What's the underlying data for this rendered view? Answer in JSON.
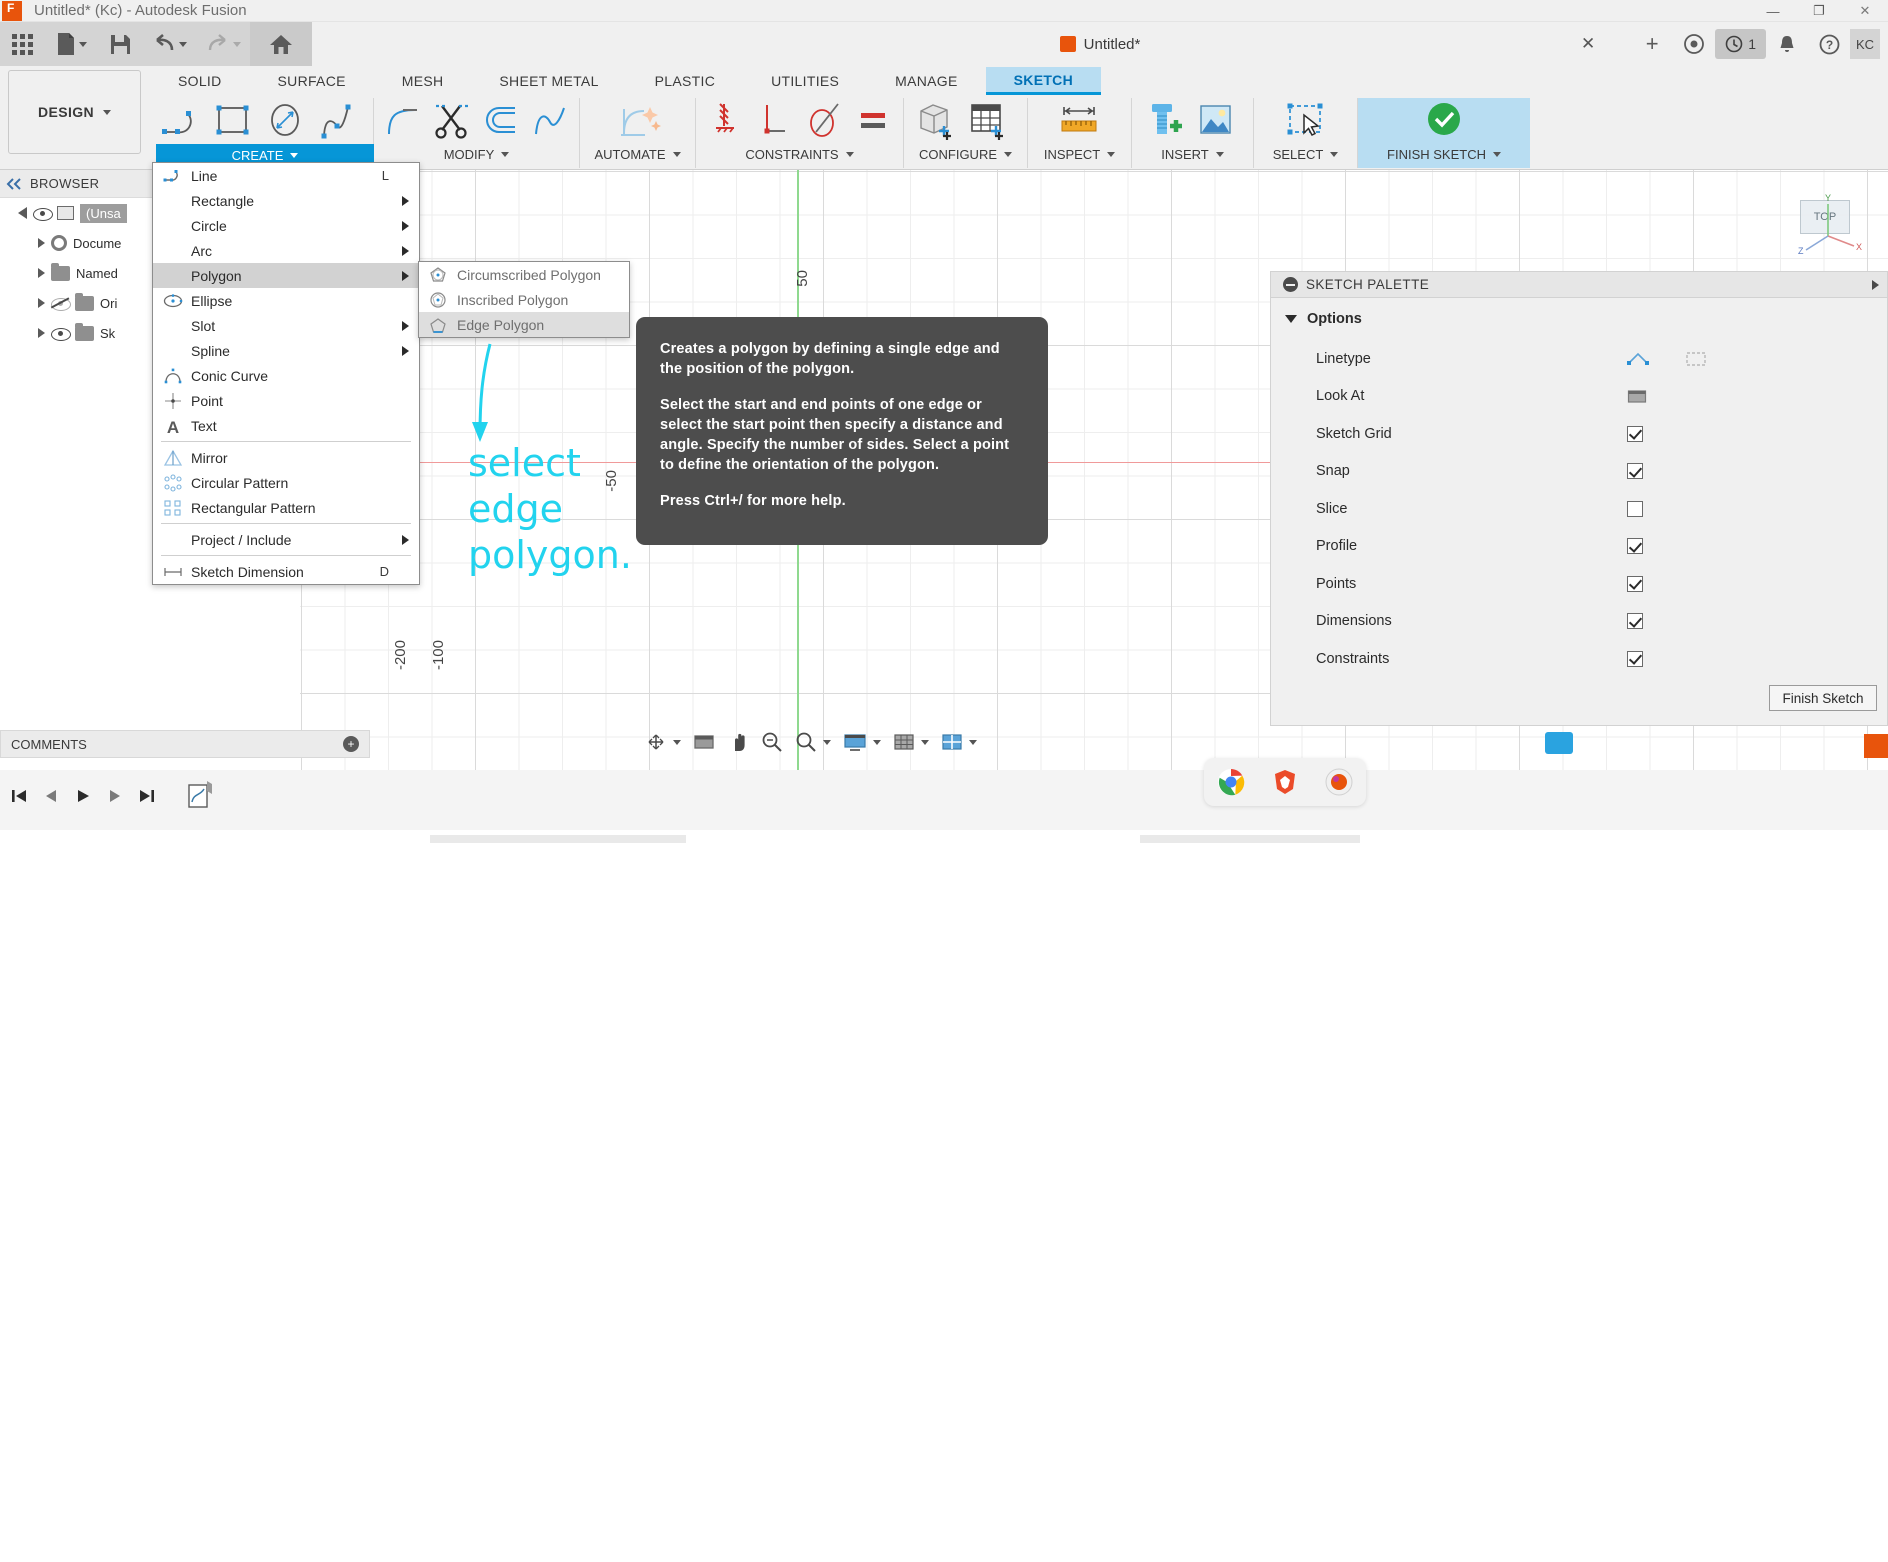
{
  "window": {
    "title": "Untitled* (Kc) - Autodesk Fusion",
    "minimize": "—",
    "maximize": "❐",
    "close": "✕"
  },
  "quick_access": {
    "grid_icon": "apps-grid-icon",
    "new_label": "new-document-icon",
    "save_label": "save-icon",
    "undo_label": "undo-icon",
    "redo_label": "redo-icon",
    "home_label": "home-icon",
    "document_tab": "Untitled*",
    "tab_close": "✕",
    "add_tab": "+",
    "help_badge": "1",
    "user_initials": "KC"
  },
  "ribbon": {
    "design_dropdown": "DESIGN",
    "tabs": [
      {
        "label": "SOLID",
        "active": false
      },
      {
        "label": "SURFACE",
        "active": false
      },
      {
        "label": "MESH",
        "active": false
      },
      {
        "label": "SHEET METAL",
        "active": false
      },
      {
        "label": "PLASTIC",
        "active": false
      },
      {
        "label": "UTILITIES",
        "active": false
      },
      {
        "label": "MANAGE",
        "active": false
      },
      {
        "label": "SKETCH",
        "active": true
      }
    ],
    "panels": [
      {
        "label": "CREATE",
        "dropdown": true,
        "active": true
      },
      {
        "label": "MODIFY",
        "dropdown": true,
        "active": false
      },
      {
        "label": "AUTOMATE",
        "dropdown": true,
        "active": false
      },
      {
        "label": "CONSTRAINTS",
        "dropdown": true,
        "active": false
      },
      {
        "label": "CONFIGURE",
        "dropdown": true,
        "active": false
      },
      {
        "label": "INSPECT",
        "dropdown": true,
        "active": false
      },
      {
        "label": "INSERT",
        "dropdown": true,
        "active": false
      },
      {
        "label": "SELECT",
        "dropdown": true,
        "active": false
      },
      {
        "label": "FINISH SKETCH",
        "dropdown": true,
        "active": false
      }
    ]
  },
  "browser": {
    "title": "BROWSER",
    "collapse_icon": "collapse-left-icon",
    "items": [
      {
        "label": "(Unsa",
        "type": "root"
      },
      {
        "label": "Docume",
        "type": "settings"
      },
      {
        "label": "Named",
        "type": "folder"
      },
      {
        "label": "Ori",
        "type": "folder",
        "hidden": true
      },
      {
        "label": "Sk",
        "type": "folder",
        "hidden": false
      }
    ]
  },
  "create_menu": {
    "items": [
      {
        "label": "Line",
        "shortcut": "L",
        "icon": "line-icon",
        "submenu": false,
        "selected": false
      },
      {
        "label": "Rectangle",
        "shortcut": "",
        "icon": "",
        "submenu": true,
        "selected": false
      },
      {
        "label": "Circle",
        "shortcut": "",
        "icon": "",
        "submenu": true,
        "selected": false
      },
      {
        "label": "Arc",
        "shortcut": "",
        "icon": "",
        "submenu": true,
        "selected": false
      },
      {
        "label": "Polygon",
        "shortcut": "",
        "icon": "",
        "submenu": true,
        "selected": true
      },
      {
        "label": "Ellipse",
        "shortcut": "",
        "icon": "ellipse-icon",
        "submenu": false,
        "selected": false
      },
      {
        "label": "Slot",
        "shortcut": "",
        "icon": "",
        "submenu": true,
        "selected": false
      },
      {
        "label": "Spline",
        "shortcut": "",
        "icon": "",
        "submenu": true,
        "selected": false
      },
      {
        "label": "Conic Curve",
        "shortcut": "",
        "icon": "conic-curve-icon",
        "submenu": false,
        "selected": false
      },
      {
        "label": "Point",
        "shortcut": "",
        "icon": "point-icon",
        "submenu": false,
        "selected": false
      },
      {
        "label": "Text",
        "shortcut": "",
        "icon": "text-icon",
        "submenu": false,
        "selected": false
      },
      {
        "label": "Mirror",
        "shortcut": "",
        "icon": "mirror-icon",
        "submenu": false,
        "selected": false
      },
      {
        "label": "Circular Pattern",
        "shortcut": "",
        "icon": "circular-pattern-icon",
        "submenu": false,
        "selected": false
      },
      {
        "label": "Rectangular Pattern",
        "shortcut": "",
        "icon": "rectangular-pattern-icon",
        "submenu": false,
        "selected": false
      },
      {
        "label": "Project / Include",
        "shortcut": "",
        "icon": "",
        "submenu": true,
        "selected": false
      },
      {
        "label": "Sketch Dimension",
        "shortcut": "D",
        "icon": "dimension-icon",
        "submenu": false,
        "selected": false
      }
    ]
  },
  "polygon_submenu": {
    "items": [
      {
        "label": "Circumscribed Polygon",
        "icon": "circumscribed-polygon-icon",
        "hot": false
      },
      {
        "label": "Inscribed Polygon",
        "icon": "inscribed-polygon-icon",
        "hot": false
      },
      {
        "label": "Edge Polygon",
        "icon": "edge-polygon-icon",
        "hot": true
      }
    ]
  },
  "tooltip": {
    "para1": "Creates a polygon by defining a single edge and the position of the polygon.",
    "para2": "Select the start and end points of one edge or select the start point then specify a distance and angle. Specify the number of sides. Select a point to define the orientation of the polygon.",
    "para3": "Press Ctrl+/ for more help."
  },
  "annotation": {
    "line1": "select",
    "line2": "edge",
    "line3": "polygon.",
    "color": "#22d3ee"
  },
  "canvas": {
    "axis_labels": [
      "-200",
      "-100",
      "-50",
      "50"
    ],
    "view_cube": "TOP",
    "axis_y": "Y",
    "axis_x": "X",
    "axis_z": "Z",
    "grid_color": "#eeeeee",
    "x_axis_color": "#f09a9a",
    "y_axis_color": "#8fd98f"
  },
  "sketch_palette": {
    "title": "SKETCH PALETTE",
    "section": "Options",
    "rows": [
      {
        "label": "Linetype",
        "type": "icons",
        "checked": false
      },
      {
        "label": "Look At",
        "type": "icon",
        "checked": false
      },
      {
        "label": "Sketch Grid",
        "type": "checkbox",
        "checked": true
      },
      {
        "label": "Snap",
        "type": "checkbox",
        "checked": true
      },
      {
        "label": "Slice",
        "type": "checkbox",
        "checked": false
      },
      {
        "label": "Profile",
        "type": "checkbox",
        "checked": true
      },
      {
        "label": "Points",
        "type": "checkbox",
        "checked": true
      },
      {
        "label": "Dimensions",
        "type": "checkbox",
        "checked": true
      },
      {
        "label": "Constraints",
        "type": "checkbox",
        "checked": true
      }
    ],
    "finish_button": "Finish Sketch"
  },
  "comments": {
    "label": "COMMENTS",
    "add_icon": "add-comment-icon"
  },
  "nav_toolbar": {
    "items": [
      {
        "name": "orbit-icon",
        "dropdown": true
      },
      {
        "name": "look-at-icon",
        "dropdown": false
      },
      {
        "name": "pan-icon",
        "dropdown": false
      },
      {
        "name": "zoom-icon",
        "dropdown": false
      },
      {
        "name": "zoom-window-icon",
        "dropdown": true
      },
      {
        "name": "display-settings-icon",
        "dropdown": true
      },
      {
        "name": "grid-snaps-icon",
        "dropdown": true
      },
      {
        "name": "viewports-icon",
        "dropdown": true
      }
    ]
  },
  "timeline": {
    "controls": [
      {
        "name": "jump-to-start-icon"
      },
      {
        "name": "step-back-icon"
      },
      {
        "name": "play-icon"
      },
      {
        "name": "step-forward-icon"
      },
      {
        "name": "jump-to-end-icon"
      },
      {
        "name": "sketch-feature-icon"
      }
    ]
  },
  "dock": {
    "apps": [
      {
        "name": "chrome-app-icon",
        "color": "#4285f4"
      },
      {
        "name": "brave-app-icon",
        "color": "#eb4c2a"
      },
      {
        "name": "fusion-app-icon",
        "color": "#e8540c"
      }
    ]
  }
}
